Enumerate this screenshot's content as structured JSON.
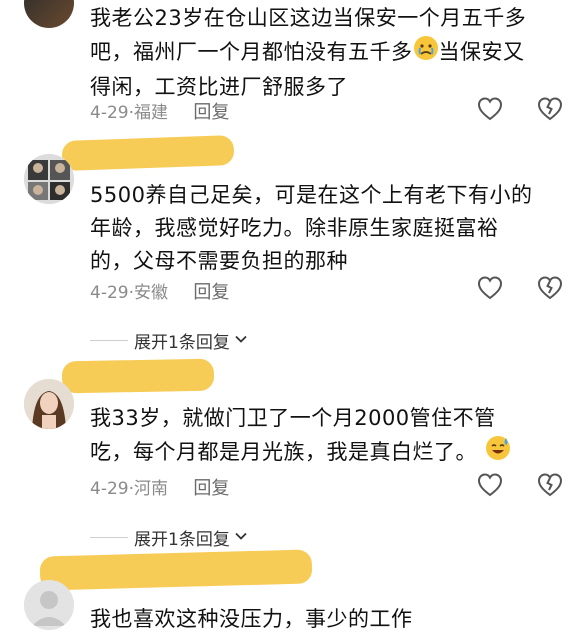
{
  "comments": [
    {
      "id": "c1",
      "lines": [
        "我老公23岁在仓山区这边当保安一个月五千多",
        "吧，福州厂一个月都怕没有五千多",
        "得闲，工资比进厂舒服多了"
      ],
      "line2_tail": "当保安又",
      "emoji": "sad-face-emoji",
      "date": "4-29",
      "location": "福建",
      "reply_label": "回复"
    },
    {
      "id": "c2",
      "lines": [
        "5500养自己足矣，可是在这个上有老下有小的",
        "年龄，我感觉好吃力。除非原生家庭挺富裕",
        "的，父母不需要负担的那种"
      ],
      "date": "4-29",
      "location": "安徽",
      "reply_label": "回复",
      "expand_label": "展开1条回复"
    },
    {
      "id": "c3",
      "lines": [
        "我33岁，就做门卫了一个月2000管住不管",
        "吃，每个月都是月光族，我是真白烂了。"
      ],
      "emoji": "sweat-smile-emoji",
      "date": "4-29",
      "location": "河南",
      "reply_label": "回复",
      "expand_label": "展开1条回复"
    },
    {
      "id": "c4",
      "lines": [
        "我也喜欢这种没压力，事少的工作"
      ]
    }
  ],
  "colors": {
    "highlight": "#f7c94d",
    "meta": "#8a8a8a",
    "text": "#111111"
  }
}
